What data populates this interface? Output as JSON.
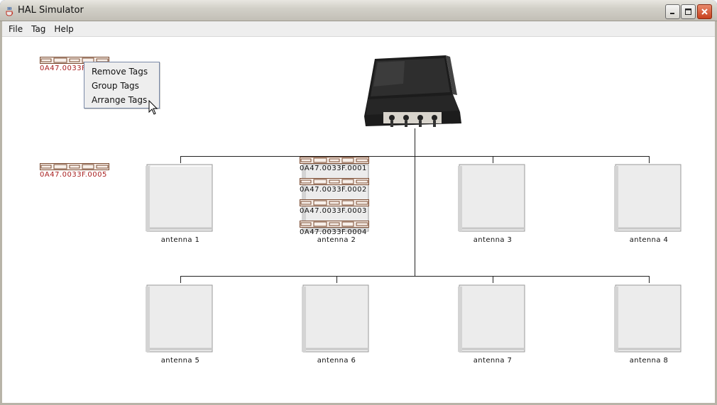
{
  "window": {
    "title": "HAL Simulator"
  },
  "menubar": {
    "items": [
      "File",
      "Tag",
      "Help"
    ]
  },
  "context_menu": {
    "items": [
      "Remove Tags",
      "Group Tags",
      "Arrange Tags"
    ]
  },
  "tags": {
    "selected_partial": "0A47.0033F",
    "loose": "0A47.0033F.0005",
    "stacked": [
      "0A47.0033F.0001",
      "0A47.0033F.0002",
      "0A47.0033F.0003",
      "0A47.0033F.0004"
    ]
  },
  "antennas": [
    "antenna 1",
    "antenna 2",
    "antenna 3",
    "antenna 4",
    "antenna 5",
    "antenna 6",
    "antenna 7",
    "antenna 8"
  ],
  "colors": {
    "tag_label": "#a82020",
    "titlebar": "#d2d0c8",
    "menu_bg": "#eeeeee"
  }
}
